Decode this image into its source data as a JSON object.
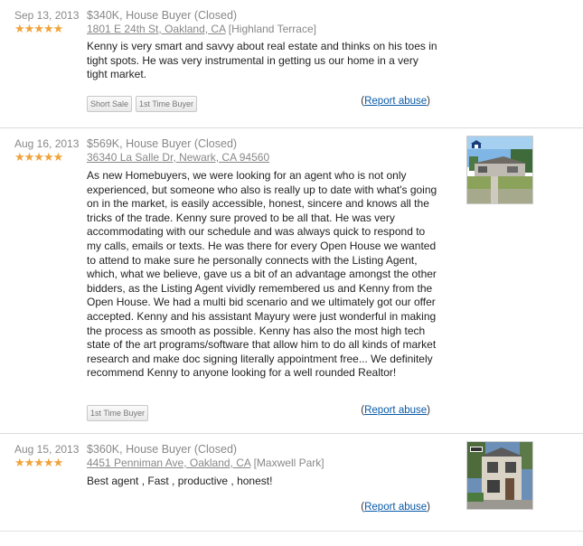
{
  "reviews": [
    {
      "date": "Sep 13, 2013",
      "stars": "★★★★★",
      "deal": "$340K, House Buyer (Closed)",
      "address": "1801 E 24th St, Oakland, CA",
      "neighborhood": "[Highland Terrace]",
      "text": "Kenny is very smart and savvy about real estate and thinks on his toes in tight spots. He was very instrumental in getting us our home in a very tight market.",
      "tags": [
        "Short Sale",
        "1st Time Buyer"
      ],
      "report_open": "(",
      "report_label": "Report abuse",
      "report_close": ")"
    },
    {
      "date": "Aug 16, 2013",
      "stars": "★★★★★",
      "deal": "$569K, House Buyer (Closed)",
      "address": "36340 La Salle Dr, Newark, CA 94560",
      "neighborhood": "",
      "text": "As new Homebuyers, we were looking for an agent who is not only experienced, but someone who also is really up to date with what's going on in the market, is easily accessible, honest, sincere and knows all the tricks of the trade. Kenny sure proved to be all that. He was very accommodating with our schedule and was always quick to respond to my calls, emails or texts. He was there for every Open House we wanted to attend to make sure he personally connects with the Listing Agent, which, what we believe, gave us a bit of an advantage amongst the other bidders, as the Listing Agent vividly remembered us and Kenny from the Open House. We had a multi bid scenario and we ultimately got our offer accepted. Kenny and his assistant Mayury were just wonderful in making the process as smooth as possible. Kenny has also the most high tech state of the art programs/software that allow him to do all kinds of market research and make doc signing literally appointment free... We definitely recommend Kenny to anyone looking for a well rounded Realtor!",
      "tags": [
        "1st Time Buyer"
      ],
      "report_open": "(",
      "report_label": "Report abuse",
      "report_close": ")"
    },
    {
      "date": "Aug 15, 2013",
      "stars": "★★★★★",
      "deal": "$360K, House Buyer (Closed)",
      "address": "4451 Penniman Ave, Oakland, CA",
      "neighborhood": "[Maxwell Park]",
      "text": "Best agent , Fast , productive , honest!",
      "tags": [],
      "report_open": "(",
      "report_label": "Report abuse",
      "report_close": ")"
    }
  ],
  "colors": {
    "star": "#f0a33a",
    "link": "#0a5aa8",
    "muted": "#888888"
  }
}
